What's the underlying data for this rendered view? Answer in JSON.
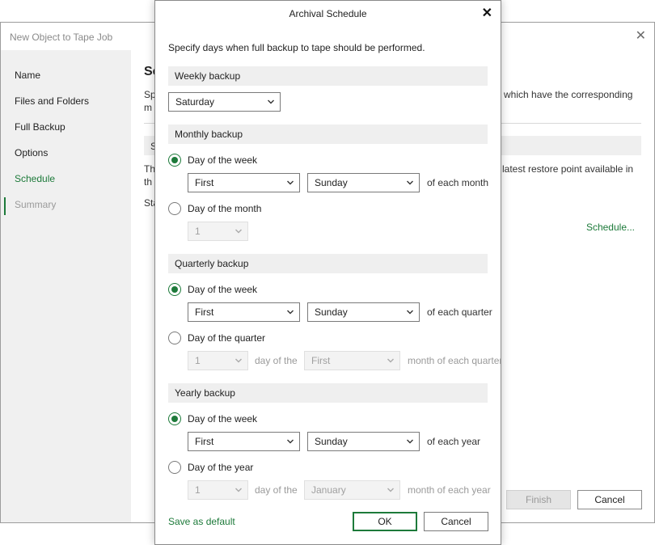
{
  "wizard": {
    "title": "New Object to Tape Job",
    "steps": [
      "Name",
      "Files and Folders",
      "Full Backup",
      "Options",
      "Schedule",
      "Summary"
    ],
    "heading_fragment": "Sc",
    "desc_fragment_1": "Sp",
    "desc_fragment_2": "m",
    "desc_fragment_right": "which have the corresponding",
    "band_fragment": "S",
    "body_fragment_1": "Th",
    "body_fragment_2": "th",
    "body_fragment_right": "latest restore point available in",
    "start_fragment": "Sta",
    "schedule_link": "Schedule...",
    "finish_label": "Finish",
    "cancel_label": "Cancel"
  },
  "dialog": {
    "title": "Archival Schedule",
    "instruction": "Specify days when full backup to tape should be performed.",
    "weekly": {
      "header": "Weekly backup",
      "day": "Saturday"
    },
    "monthly": {
      "header": "Monthly backup",
      "opt_week_label": "Day of the week",
      "ordinal": "First",
      "weekday": "Sunday",
      "week_suffix": "of each month",
      "opt_month_label": "Day of the month",
      "day_number": "1"
    },
    "quarterly": {
      "header": "Quarterly backup",
      "opt_week_label": "Day of the week",
      "ordinal": "First",
      "weekday": "Sunday",
      "week_suffix": "of each quarter",
      "opt_quarter_label": "Day of the quarter",
      "day_number": "1",
      "day_of_the": "day of the",
      "month_ordinal": "First",
      "month_suffix": "month of each quarter"
    },
    "yearly": {
      "header": "Yearly backup",
      "opt_week_label": "Day of the week",
      "ordinal": "First",
      "weekday": "Sunday",
      "week_suffix": "of each year",
      "opt_year_label": "Day of the year",
      "day_number": "1",
      "day_of_the": "day of the",
      "month": "January",
      "month_suffix": "month of each year"
    },
    "save_default": "Save as default",
    "ok_label": "OK",
    "cancel_label": "Cancel"
  },
  "colors": {
    "accent": "#1d7a3a",
    "section_band": "#efefef",
    "sidebar": "#f0f0f0"
  },
  "icons": [
    "close-icon",
    "chevron-down-icon"
  ]
}
